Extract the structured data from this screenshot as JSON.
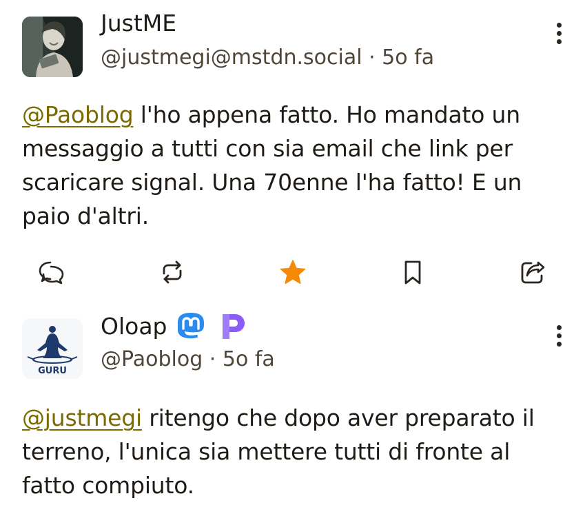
{
  "posts": [
    {
      "display_name": "JustME",
      "handle": "@justmegi@mstdn.social",
      "time": "5o fa",
      "mention": "@Paoblog",
      "text": " l'ho appena fatto. Ho mandato un messaggio a tutti con sia email che link per scaricare signal. Una 70enne l'ha fatto! E un paio d'altri.",
      "actions": [
        "reply-icon",
        "boost-icon",
        "favourite-icon",
        "bookmark-icon",
        "share-icon"
      ],
      "favourited": true,
      "accent_color": "#f58a07"
    },
    {
      "display_name": "Oloap",
      "handle": "@Paoblog",
      "time": "5o fa",
      "avatar_label": "GURU",
      "mention": "@justmegi",
      "text": " ritengo che dopo aver preparato il terreno, l'unica sia mettere tutti di fronte al fatto compiuto."
    }
  ],
  "separator": " · "
}
